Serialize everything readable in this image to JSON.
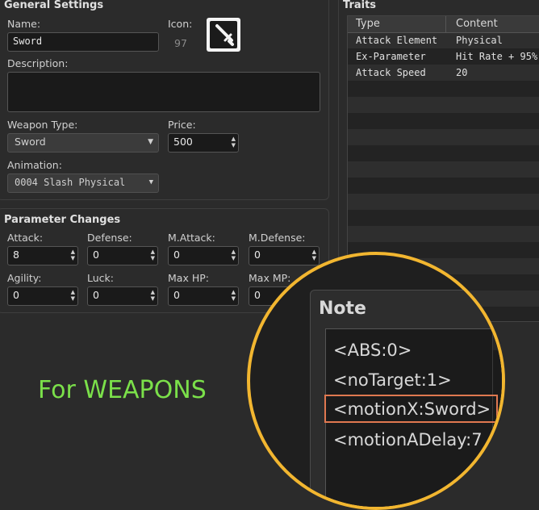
{
  "general": {
    "title": "General Settings",
    "name_label": "Name:",
    "name_value": "Sword",
    "icon_label": "Icon:",
    "icon_index": "97",
    "description_label": "Description:",
    "description_value": "",
    "weapon_type_label": "Weapon Type:",
    "weapon_type_value": "Sword",
    "price_label": "Price:",
    "price_value": "500",
    "animation_label": "Animation:",
    "animation_value": "0004 Slash Physical"
  },
  "params": {
    "title": "Parameter Changes",
    "items": [
      {
        "label": "Attack:",
        "value": "8"
      },
      {
        "label": "Defense:",
        "value": "0"
      },
      {
        "label": "M.Attack:",
        "value": "0"
      },
      {
        "label": "M.Defense:",
        "value": "0"
      },
      {
        "label": "Agility:",
        "value": "0"
      },
      {
        "label": "Luck:",
        "value": "0"
      },
      {
        "label": "Max HP:",
        "value": "0"
      },
      {
        "label": "Max MP:",
        "value": "0"
      }
    ]
  },
  "traits": {
    "title": "Traits",
    "col_type": "Type",
    "col_content": "Content",
    "rows": [
      {
        "type": "Attack Element",
        "content": "Physical"
      },
      {
        "type": "Ex-Parameter",
        "content": "Hit Rate + 95%"
      },
      {
        "type": "Attack Speed",
        "content": "20"
      }
    ]
  },
  "note": {
    "title": "Note",
    "lines": [
      "<ABS:0>",
      "<noTarget:1>",
      "<motionX:Sword>",
      "<motionADelay:7"
    ],
    "highlight_index": 2
  },
  "caption": "For WEAPONS",
  "colors": {
    "background": "#2b2b2b",
    "caption_green": "#7be04a",
    "lens_ring": "#f2b630",
    "highlight_box": "#e07850"
  },
  "icons": {
    "weapon_icon": "sword-icon",
    "dropdown": "chevron-down-icon",
    "spinner": "up-down-arrows-icon"
  }
}
